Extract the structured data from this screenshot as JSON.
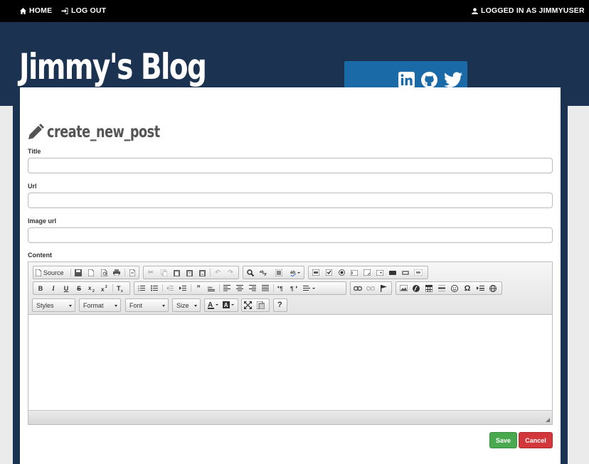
{
  "nav": {
    "home_label": "HOME",
    "logout_label": "LOG OUT",
    "user_label": "LOGGED IN AS JIMMYUSER"
  },
  "header": {
    "blog_title": "Jimmy's Blog",
    "social_icons": [
      "linkedin-icon",
      "github-icon",
      "twitter-icon"
    ]
  },
  "page": {
    "title": "create_new_post"
  },
  "form": {
    "title_label": "Title",
    "title_value": "",
    "url_label": "Url",
    "url_value": "",
    "image_label": "Image url",
    "image_value": "",
    "content_label": "Content"
  },
  "editor": {
    "source_label": "Source",
    "styles_label": "Styles",
    "format_label": "Format",
    "font_label": "Font",
    "size_label": "Size",
    "help_label": "?",
    "bold_label": "B",
    "italic_label": "I",
    "underline_label": "U",
    "strike_label": "S"
  },
  "actions": {
    "save_label": "Save",
    "cancel_label": "Cancel"
  },
  "colors": {
    "header_bg": "#1c3251",
    "social_bg": "#1a6aa8",
    "save_bg": "#4aa94e",
    "cancel_bg": "#d2383b"
  }
}
